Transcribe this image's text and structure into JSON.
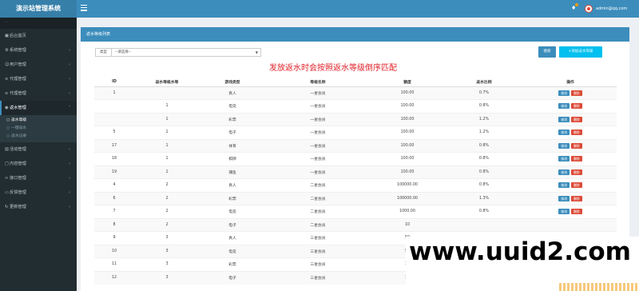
{
  "app": {
    "title": "演示站管理系统"
  },
  "header": {
    "user_name": "admin@qq.com"
  },
  "sidebar": {
    "heading": "···",
    "items": [
      {
        "label": "后台首页",
        "icon": "dashboard-icon",
        "expandable": false
      },
      {
        "label": "系统管理",
        "icon": "gear-icon",
        "expandable": true
      },
      {
        "label": "用户管理",
        "icon": "users-icon",
        "expandable": true
      },
      {
        "label": "代理管理",
        "icon": "list-icon",
        "expandable": true
      },
      {
        "label": "代理管理",
        "icon": "list-icon",
        "expandable": true
      },
      {
        "label": "返水管理",
        "icon": "eye-icon",
        "expandable": true,
        "open": true,
        "children": [
          {
            "label": "返水等级",
            "active": true
          },
          {
            "label": "一键返水",
            "active": false
          },
          {
            "label": "返水记录",
            "active": false
          }
        ]
      },
      {
        "label": "活动管理",
        "icon": "gift-icon",
        "expandable": true
      },
      {
        "label": "内容管理",
        "icon": "file-icon",
        "expandable": true
      },
      {
        "label": "接口管理",
        "icon": "link-icon",
        "expandable": true
      },
      {
        "label": "反馈管理",
        "icon": "comment-icon",
        "expandable": true
      },
      {
        "label": "更新管理",
        "icon": "refresh-icon",
        "expandable": true
      }
    ]
  },
  "panel": {
    "title": "返水等级列表",
    "filter_label": "类型",
    "filter_value": "--请选择--",
    "search_label": "搜索",
    "add_label": "+添加返水等级",
    "notice": "发放返水时会按照返水等级倒序匹配"
  },
  "table": {
    "headers": [
      "ID",
      "返水等级水等",
      "游戏类型",
      "等级名称",
      "额度",
      "返水比例",
      "操作"
    ],
    "edit_label": "修改",
    "delete_label": "删除",
    "rows": [
      {
        "id": "1",
        "level": "",
        "game": "真人",
        "name": "一星会员",
        "amount": "100.00",
        "ratio": "0.7%",
        "ops": true
      },
      {
        "id": "",
        "level": "1",
        "game": "电竞",
        "name": "一星会员",
        "amount": "100.00",
        "ratio": "0.8%",
        "ops": true
      },
      {
        "id": "",
        "level": "1",
        "game": "彩票",
        "name": "一星会员",
        "amount": "100.00",
        "ratio": "1.2%",
        "ops": true
      },
      {
        "id": "5",
        "level": "1",
        "game": "电子",
        "name": "一星会员",
        "amount": "100.00",
        "ratio": "1.2%",
        "ops": true
      },
      {
        "id": "17",
        "level": "1",
        "game": "体育",
        "name": "一星会员",
        "amount": "100.00",
        "ratio": "0.8%",
        "ops": true
      },
      {
        "id": "18",
        "level": "1",
        "game": "棋牌",
        "name": "一星会员",
        "amount": "100.00",
        "ratio": "0.8%",
        "ops": true
      },
      {
        "id": "19",
        "level": "1",
        "game": "捕鱼",
        "name": "一星会员",
        "amount": "100.00",
        "ratio": "0.8%",
        "ops": true
      },
      {
        "id": "4",
        "level": "2",
        "game": "真人",
        "name": "二星会员",
        "amount": "100000.00",
        "ratio": "0.8%",
        "ops": true
      },
      {
        "id": "6",
        "level": "2",
        "game": "彩票",
        "name": "二星会员",
        "amount": "100000.00",
        "ratio": "1.3%",
        "ops": true
      },
      {
        "id": "7",
        "level": "2",
        "game": "电竞",
        "name": "二星会员",
        "amount": "1000.00",
        "ratio": "0.8%",
        "ops": true
      },
      {
        "id": "8",
        "level": "2",
        "game": "电子",
        "name": "二星会员",
        "amount": "10",
        "ratio": "",
        "ops": false
      },
      {
        "id": "9",
        "level": "3",
        "game": "真人",
        "name": "三星会员",
        "amount": "50",
        "ratio": "",
        "ops": false
      },
      {
        "id": "10",
        "level": "3",
        "game": "电竞",
        "name": "三星会员",
        "amount": "50",
        "ratio": "",
        "ops": false
      },
      {
        "id": "11",
        "level": "3",
        "game": "彩票",
        "name": "三星会员",
        "amount": "30",
        "ratio": "",
        "ops": false
      },
      {
        "id": "12",
        "level": "3",
        "game": "电子",
        "name": "三星会员",
        "amount": "30",
        "ratio": "",
        "ops": false
      }
    ]
  },
  "watermark": {
    "text": "www.uuid2.com"
  },
  "colors": {
    "header": "#3c8dbc",
    "logo": "#367fa9",
    "sidebar": "#222d32",
    "add_button": "#00c0ef",
    "delete_button": "#dd4b39",
    "notice": "#e0222a"
  }
}
